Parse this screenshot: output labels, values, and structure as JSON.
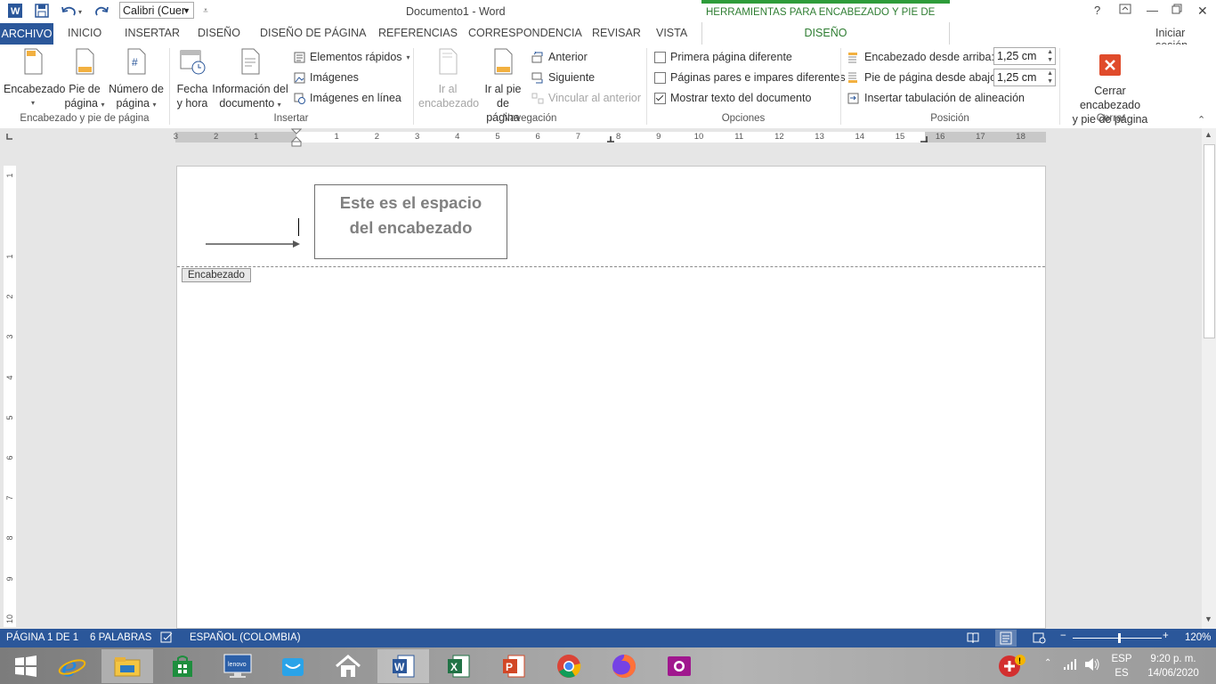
{
  "titlebar": {
    "font_name": "Calibri (Cuer",
    "document_title": "Documento1 - Word",
    "contextual_title": "HERRAMIENTAS PARA ENCABEZADO Y PIE DE PÁGINA",
    "help": "?"
  },
  "tabs": {
    "archivo": "ARCHIVO",
    "items": [
      "INICIO",
      "INSERTAR",
      "DISEÑO",
      "DISEÑO DE PÁGINA",
      "REFERENCIAS",
      "CORRESPONDENCIA",
      "REVISAR",
      "VISTA"
    ],
    "active": "DISEÑO",
    "sign_in": "Iniciar sesión"
  },
  "ribbon": {
    "group1": {
      "label": "Encabezado y pie de página",
      "encabezado": "Encabezado",
      "pie_1": "Pie de",
      "pie_2": "página",
      "numero_1": "Número de",
      "numero_2": "página"
    },
    "insertar": {
      "label": "Insertar",
      "fecha_1": "Fecha",
      "fecha_2": "y hora",
      "info_1": "Información del",
      "info_2": "documento",
      "elementos": "Elementos rápidos",
      "imagenes": "Imágenes",
      "imagenes_linea": "Imágenes en línea"
    },
    "navegacion": {
      "label": "Navegación",
      "ir_encabezado_1": "Ir al",
      "ir_encabezado_2": "encabezado",
      "ir_pie_1": "Ir al pie",
      "ir_pie_2": "de página",
      "anterior": "Anterior",
      "siguiente": "Siguiente",
      "vincular": "Vincular al anterior"
    },
    "opciones": {
      "label": "Opciones",
      "primera": "Primera página diferente",
      "primera_checked": false,
      "pares": "Páginas pares e impares diferentes",
      "pares_checked": false,
      "mostrar": "Mostrar texto del documento",
      "mostrar_checked": true
    },
    "posicion": {
      "label": "Posición",
      "encabezado_desde": "Encabezado desde arriba:",
      "encabezado_valor": "1,25 cm",
      "pie_desde": "Pie de página desde abajo:",
      "pie_valor": "1,25 cm",
      "tabulacion": "Insertar tabulación de alineación"
    },
    "cerrar": {
      "label": "Cerrar",
      "btn_1": "Cerrar encabezado",
      "btn_2": "y pie de página"
    }
  },
  "ruler": {
    "h_numbers": [
      "3",
      "2",
      "1",
      "1",
      "2",
      "3",
      "4",
      "5",
      "6",
      "7",
      "8",
      "9",
      "10",
      "11",
      "12",
      "13",
      "14",
      "15",
      "16",
      "17",
      "18"
    ],
    "v_numbers": [
      "1",
      "1",
      "2",
      "3",
      "4",
      "5",
      "6",
      "7",
      "8",
      "9",
      "10"
    ]
  },
  "document": {
    "header_text_1": "Este es el espacio",
    "header_text_2": "del encabezado",
    "header_tag": "Encabezado"
  },
  "statusbar": {
    "page": "PÁGINA 1 DE 1",
    "words": "6 PALABRAS",
    "language": "ESPAÑOL (COLOMBIA)",
    "zoom": "120%",
    "zoom_fraction": 0.52
  },
  "taskbar": {
    "lang1": "ESP",
    "lang2": "ES",
    "time": "9:20 p. m.",
    "date": "14/06/2020"
  },
  "colors": {
    "word_blue": "#2b579a",
    "contextual_green": "#2e7d32",
    "close_red": "#e04b2b"
  }
}
